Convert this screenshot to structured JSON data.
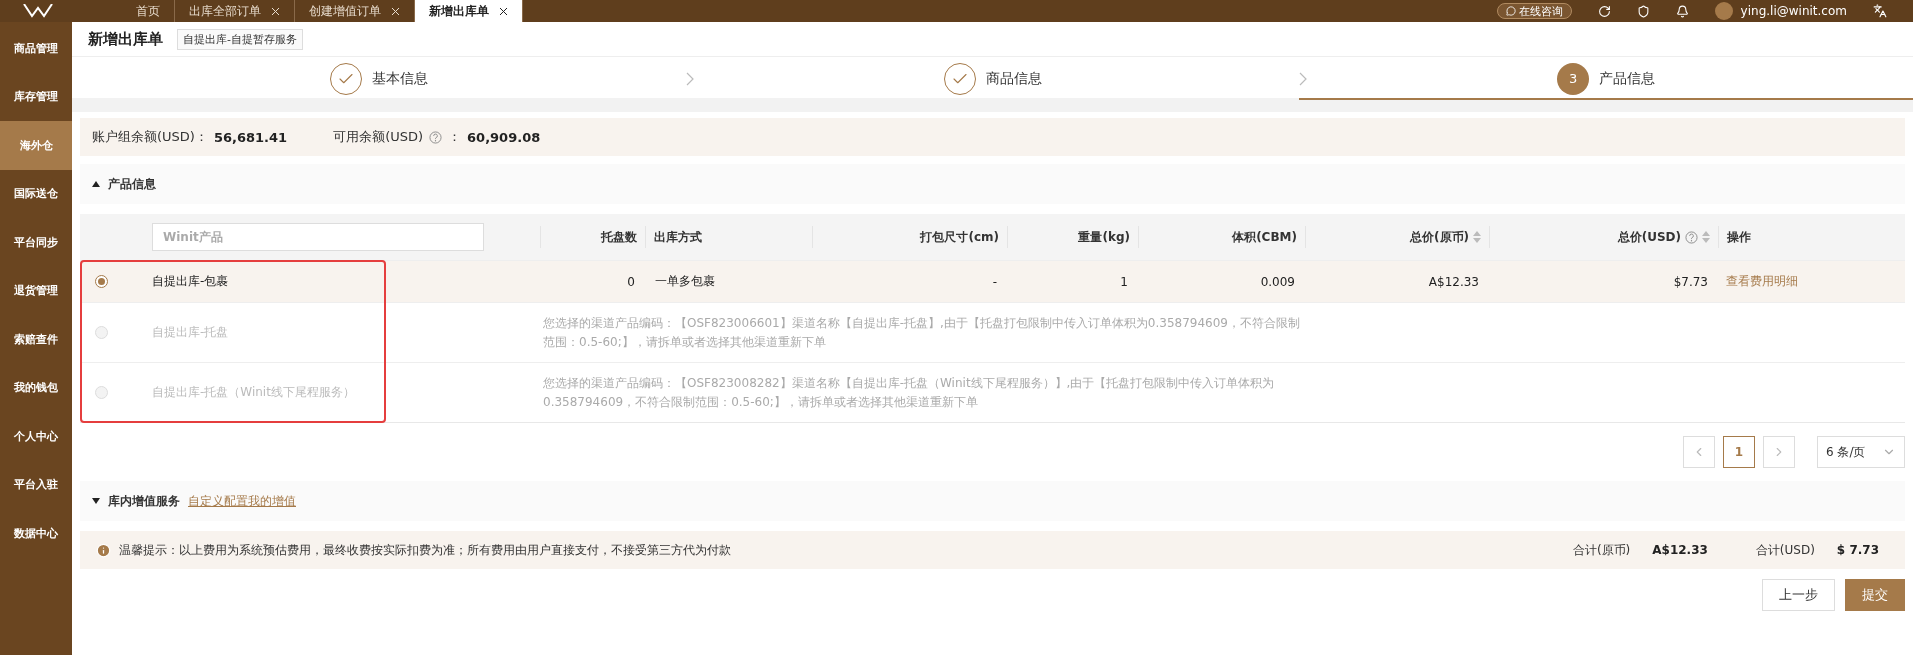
{
  "top_bar": {
    "tabs": [
      {
        "label": "首页",
        "closable": false,
        "selected": false
      },
      {
        "label": "出库全部订单",
        "closable": true,
        "selected": false
      },
      {
        "label": "创建增值订单",
        "closable": true,
        "selected": false
      },
      {
        "label": "新增出库单",
        "closable": true,
        "selected": true
      }
    ],
    "consult_button": "在线咨询",
    "user": "ying.li@winit.com"
  },
  "sidebar": {
    "items": [
      {
        "label": "商品管理",
        "selected": false
      },
      {
        "label": "库存管理",
        "selected": false
      },
      {
        "label": "海外仓",
        "selected": true
      },
      {
        "label": "国际送仓",
        "selected": false
      },
      {
        "label": "平台同步",
        "selected": false
      },
      {
        "label": "退货管理",
        "selected": false
      },
      {
        "label": "索赔查件",
        "selected": false
      },
      {
        "label": "我的钱包",
        "selected": false
      },
      {
        "label": "个人中心",
        "selected": false
      },
      {
        "label": "平台入驻",
        "selected": false
      },
      {
        "label": "数据中心",
        "selected": false
      }
    ]
  },
  "page": {
    "title": "新增出库单",
    "tag": "自提出库-自提暂存服务"
  },
  "steps": [
    {
      "label": "基本信息",
      "done": true,
      "selected": false
    },
    {
      "label": "商品信息",
      "done": true,
      "selected": false
    },
    {
      "label": "产品信息",
      "number": "3",
      "done": false,
      "selected": true
    }
  ],
  "balance": {
    "group_label": "账户组余额(USD)：",
    "group_value": "56,681.41",
    "available_label": "可用余额(USD)",
    "available_sep": "：",
    "available_value": "60,909.08"
  },
  "product_section": {
    "title": "产品信息",
    "expanded": true
  },
  "table": {
    "search_placeholder": "Winit产品",
    "highlight_box": true,
    "columns": [
      {
        "label": "托盘数",
        "sortable": false,
        "help": false
      },
      {
        "label": "出库方式",
        "sortable": false,
        "help": false
      },
      {
        "label": "打包尺寸(cm)",
        "sortable": false,
        "help": false
      },
      {
        "label": "重量(kg)",
        "sortable": false,
        "help": false
      },
      {
        "label": "体积(CBM)",
        "sortable": false,
        "help": false
      },
      {
        "label": "总价(原币)",
        "sortable": true,
        "help": false
      },
      {
        "label": "总价(USD)",
        "sortable": true,
        "help": true
      },
      {
        "label": "操作",
        "sortable": false,
        "help": false
      }
    ],
    "rows": [
      {
        "kind": "priced",
        "name": "自提出库-包裹",
        "selected": true,
        "disabled": false,
        "cells": [
          "0",
          "一单多包裹",
          "-",
          "1",
          "0.009",
          "A$12.33",
          "$7.73"
        ],
        "action": "查看费用明细"
      },
      {
        "kind": "unavailable",
        "name": "自提出库-托盘",
        "selected": false,
        "disabled": true,
        "message": "您选择的渠道产品编码：【OSF823006601】渠道名称【自提出库-托盘】,由于【托盘打包限制中传入订单体积为0.358794609，不符合限制范围：0.5-60;】，请拆单或者选择其他渠道重新下单"
      },
      {
        "kind": "unavailable",
        "name": "自提出库-托盘（Winit线下尾程服务）",
        "selected": false,
        "disabled": true,
        "message": "您选择的渠道产品编码：【OSF823008282】渠道名称【自提出库-托盘（Winit线下尾程服务）】,由于【托盘打包限制中传入订单体积为0.358794609，不符合限制范围：0.5-60;】，请拆单或者选择其他渠道重新下单"
      }
    ]
  },
  "pagination": {
    "current": "1",
    "page_size": "6 条/页"
  },
  "value_added": {
    "title": "库内增值服务",
    "expanded": false,
    "link": "自定义配置我的增值"
  },
  "tip": {
    "text": "温馨提示：以上费用为系统预估费用，最终收费按实际扣费为准；所有费用由用户直接支付，不接受第三方代为付款",
    "total_orig_label": "合计(原币)",
    "total_orig": "A$12.33",
    "total_usd_label": "合计(USD)",
    "total_usd": "$ 7.73"
  },
  "buttons": [
    {
      "label": "上一步",
      "kind": "secondary"
    },
    {
      "label": "提交",
      "kind": "primary"
    }
  ]
}
